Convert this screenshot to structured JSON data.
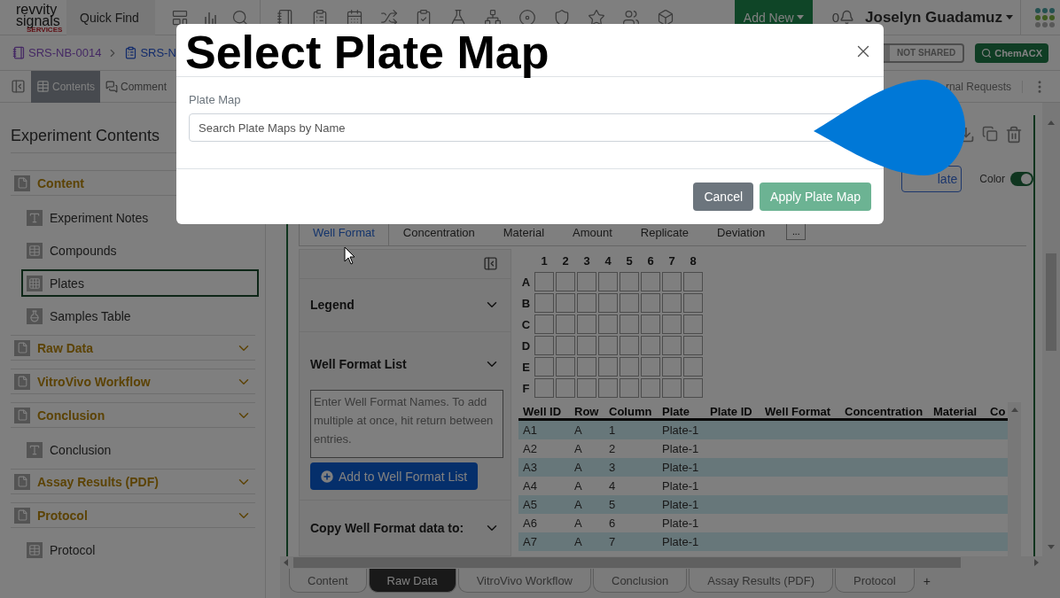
{
  "header": {
    "logo": {
      "line1": "revvity",
      "line2": "signals",
      "tag": "SERVICES"
    },
    "quick_find": "Quick Find",
    "add_new": "Add New",
    "notifications": "0",
    "user": "Joselyn Guadamuz"
  },
  "breadcrumb": [
    {
      "label": "SRS-NB-0014",
      "kind": "notebook"
    },
    {
      "label": "SRS-N",
      "kind": "experiment"
    }
  ],
  "sharing": {
    "label": "NOT SHARED"
  },
  "chemacx": "ChemACX",
  "view_tabs": [
    {
      "label": "Contents",
      "selected": true
    },
    {
      "label": "Comment",
      "selected": false
    }
  ],
  "requests": "rnal Requests",
  "sidebar": {
    "title": "Experiment Contents",
    "sections": [
      {
        "label": "Content",
        "toggle": false,
        "children": [
          {
            "label": "Experiment Notes",
            "kind": "text",
            "selected": false
          },
          {
            "label": "Compounds",
            "kind": "table",
            "selected": false
          },
          {
            "label": "Plates",
            "kind": "plate",
            "selected": true
          },
          {
            "label": "Samples Table",
            "kind": "samples",
            "selected": false
          }
        ]
      },
      {
        "label": "Raw Data",
        "toggle": true
      },
      {
        "label": "VitroVivo Workflow",
        "toggle": true
      },
      {
        "label": "Conclusion",
        "toggle": true,
        "children": [
          {
            "label": "Conclusion",
            "kind": "text",
            "selected": false
          }
        ]
      },
      {
        "label": "Assay Results (PDF)",
        "toggle": true
      },
      {
        "label": "Protocol",
        "toggle": true,
        "children": [
          {
            "label": "Protocol",
            "kind": "table",
            "selected": false
          }
        ]
      }
    ]
  },
  "plate": {
    "add_button": "late",
    "color": {
      "label": "Color",
      "on": true
    },
    "tabs": [
      {
        "label": "Well Format",
        "selected": true
      },
      {
        "label": "Concentration",
        "selected": false
      },
      {
        "label": "Material",
        "selected": false
      },
      {
        "label": "Amount",
        "selected": false
      },
      {
        "label": "Replicate",
        "selected": false
      },
      {
        "label": "Deviation",
        "selected": false
      }
    ],
    "more": "...",
    "legend": "Legend",
    "well_format_list": {
      "title": "Well Format List",
      "placeholder": "Enter Well Format Names. To add multiple at once, hit return between entries.",
      "button": "Add to Well Format List"
    },
    "copy_title": "Copy Well Format data to:",
    "grid": {
      "columns": [
        "1",
        "2",
        "3",
        "4",
        "5",
        "6",
        "7",
        "8"
      ],
      "rows": [
        "A",
        "B",
        "C",
        "D",
        "E",
        "F"
      ]
    },
    "table": {
      "columns": [
        "Well ID",
        "Row",
        "Column",
        "Plate",
        "Plate ID",
        "Well Format",
        "Concentration",
        "Material",
        "Co"
      ],
      "rows": [
        {
          "well_id": "A1",
          "row": "A",
          "column": "1",
          "plate": "Plate-1"
        },
        {
          "well_id": "A2",
          "row": "A",
          "column": "2",
          "plate": "Plate-1"
        },
        {
          "well_id": "A3",
          "row": "A",
          "column": "3",
          "plate": "Plate-1"
        },
        {
          "well_id": "A4",
          "row": "A",
          "column": "4",
          "plate": "Plate-1"
        },
        {
          "well_id": "A5",
          "row": "A",
          "column": "5",
          "plate": "Plate-1"
        },
        {
          "well_id": "A6",
          "row": "A",
          "column": "6",
          "plate": "Plate-1"
        },
        {
          "well_id": "A7",
          "row": "A",
          "column": "7",
          "plate": "Plate-1"
        }
      ]
    }
  },
  "sheet_tabs": [
    {
      "label": "Content",
      "selected": false
    },
    {
      "label": "Raw Data",
      "selected": true
    },
    {
      "label": "VitroVivo Workflow",
      "selected": false
    },
    {
      "label": "Conclusion",
      "selected": false
    },
    {
      "label": "Assay Results (PDF)",
      "selected": false
    },
    {
      "label": "Protocol",
      "selected": false
    }
  ],
  "add_sheet": "+",
  "modal": {
    "title": "Select Plate Map",
    "field_label": "Plate Map",
    "placeholder": "Search Plate Maps by Name",
    "cancel": "Cancel",
    "apply": "Apply Plate Map"
  }
}
